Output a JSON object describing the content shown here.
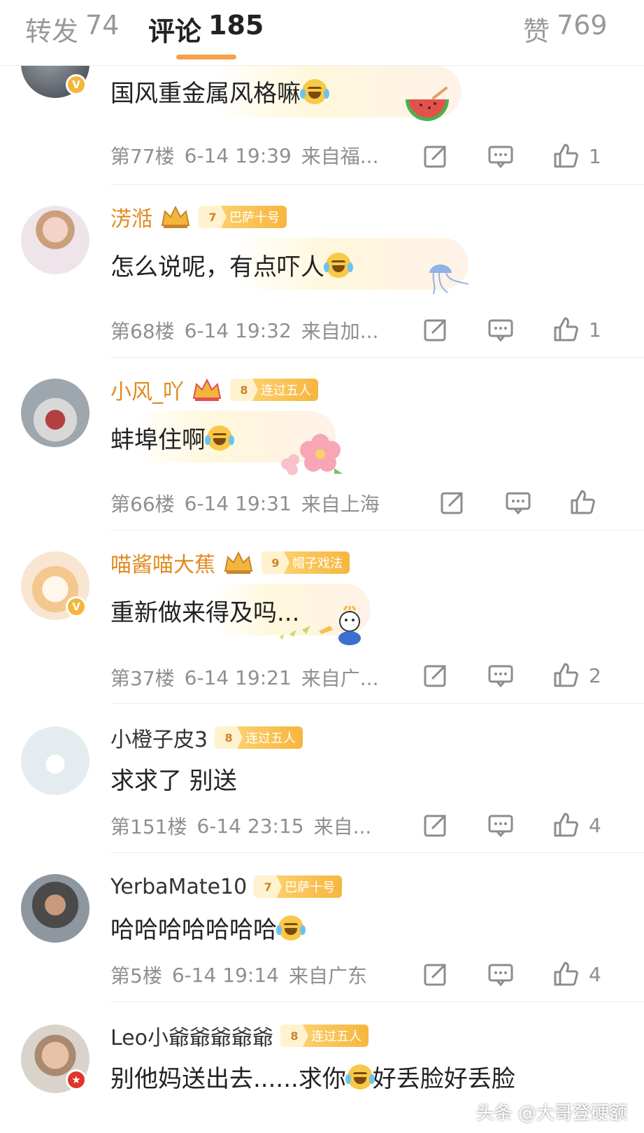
{
  "tabs": [
    {
      "label": "转发",
      "count": "74"
    },
    {
      "label": "评论",
      "count": "185"
    },
    {
      "label": "赞",
      "count": "769"
    }
  ],
  "comments": [
    {
      "username": "",
      "content": "国风重金属风格嘛",
      "floor": "第77楼",
      "time": "6-14 19:39",
      "location": "来自福...",
      "likes": "1"
    },
    {
      "username": "淓湉",
      "fan_level": "7",
      "fan_name": "巴萨十号",
      "content": "怎么说呢，有点吓人",
      "floor": "第68楼",
      "time": "6-14 19:32",
      "location": "来自加...",
      "likes": "1"
    },
    {
      "username": "小风_吖",
      "fan_level": "8",
      "fan_name": "连过五人",
      "content": "蚌埠住啊",
      "floor": "第66楼",
      "time": "6-14 19:31",
      "location": "来自上海",
      "likes": ""
    },
    {
      "username": "喵酱喵大蕉",
      "fan_level": "9",
      "fan_name": "帽子戏法",
      "content": "重新做来得及吗...",
      "floor": "第37楼",
      "time": "6-14 19:21",
      "location": "来自广...",
      "likes": "2"
    },
    {
      "username": "小橙子皮3",
      "fan_level": "8",
      "fan_name": "连过五人",
      "content": "求求了 别送",
      "floor": "第151楼",
      "time": "6-14 23:15",
      "location": "来自...",
      "likes": "4"
    },
    {
      "username": "YerbaMate10",
      "fan_level": "7",
      "fan_name": "巴萨十号",
      "content": "哈哈哈哈哈哈哈",
      "floor": "第5楼",
      "time": "6-14 19:14",
      "location": "来自广东",
      "likes": "4"
    },
    {
      "username": "Leo小爺爺爺爺爺",
      "fan_level": "8",
      "fan_name": "连过五人",
      "content_a": "别他妈送出去......求你",
      "content_b": "好丢脸好丢脸"
    }
  ],
  "watermark": "头条 @大哥登硬额",
  "colors": {
    "accent": "#f6a14a",
    "gold_name": "#e08a1e",
    "meta": "#8f8f8f",
    "vip": "#f4b63a"
  },
  "icons": [
    "repost-icon",
    "comment-icon",
    "like-icon",
    "laugh-cry-emoji",
    "crown-icon",
    "verified-badge-icon"
  ]
}
